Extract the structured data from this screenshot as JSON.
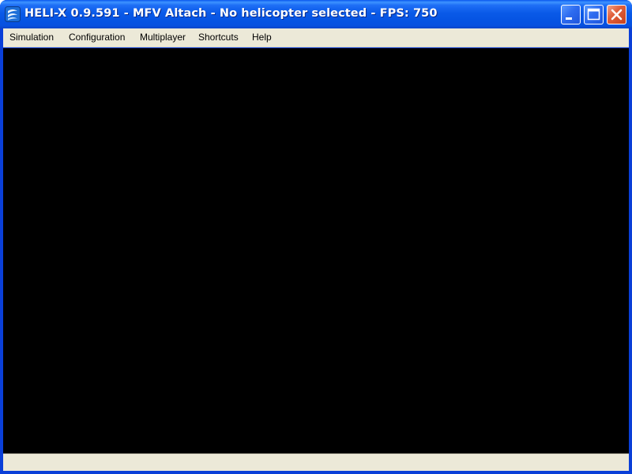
{
  "window": {
    "title": "HELI-X 0.9.591 - MFV Altach - No helicopter selected - FPS: 750",
    "icon": "heli-x-app-icon",
    "controls": {
      "minimize": "minimize-icon",
      "maximize": "maximize-icon",
      "close": "close-icon"
    }
  },
  "menubar": {
    "items": [
      {
        "label": "Simulation"
      },
      {
        "label": "Configuration"
      },
      {
        "label": "Multiplayer"
      },
      {
        "label": "Shortcuts"
      },
      {
        "label": "Help"
      }
    ]
  },
  "viewport": {
    "background": "#000000"
  },
  "statusbar": {
    "text": ""
  },
  "colors": {
    "titlebar": "#0a5ae8",
    "frame": "#0a3fd8",
    "menubar": "#ece9d8",
    "close_button": "#e0603c"
  }
}
